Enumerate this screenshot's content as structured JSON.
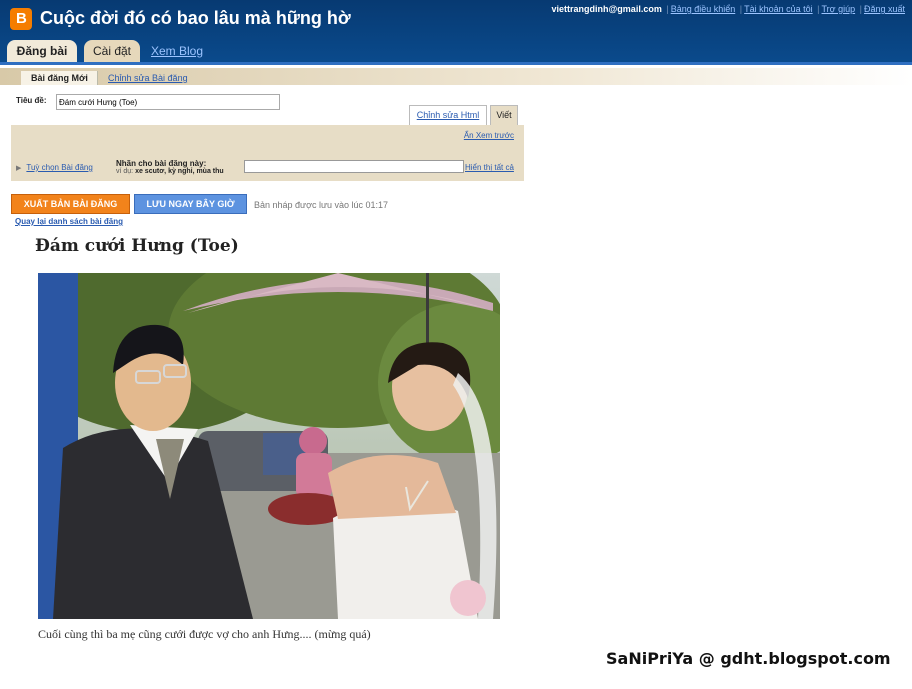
{
  "header": {
    "blog_title": "Cuộc đời đó có bao lâu mà hững hờ",
    "email": "viettrangdinh@gmail.com",
    "links": [
      "Bảng điều khiển",
      "Tài khoản của tôi",
      "Trợ giúp",
      "Đăng xuất"
    ],
    "tabs": [
      "Đăng bài",
      "Cài đặt",
      "Xem Blog"
    ]
  },
  "subtabs": [
    "Bài đăng Mới",
    "Chỉnh sửa Bài đăng"
  ],
  "editor": {
    "title_label": "Tiêu đề:",
    "title_value": "Đám cưới Hưng (Toe)",
    "mode_tabs": [
      "Chỉnh sửa Html",
      "Viết"
    ],
    "preview_link": "Ẩn Xem trước",
    "post_options_link": "Tuỳ chọn Bài đăng",
    "labels_heading": "Nhãn cho bài đăng này:",
    "labels_example_prefix": "ví dụ: ",
    "labels_example": "xe scutơ, kỳ nghỉ, mùa thu",
    "show_all_link": "Hiển thị tất cả"
  },
  "actions": {
    "publish": "XUẤT BẢN BÀI ĐĂNG",
    "save": "LƯU NGAY BÂY GIỜ",
    "draft_status": "Bản nháp được lưu vào lúc 01:17",
    "back_link": "Quay lại danh sách bài đăng"
  },
  "post": {
    "title": "Đám cưới Hưng (Toe)",
    "caption": "Cuối cùng thì ba mẹ cũng cưới được vợ cho anh Hưng.... (mừng quá)"
  },
  "watermark": "SaNiPriYa @ gdht.blogspot.com"
}
